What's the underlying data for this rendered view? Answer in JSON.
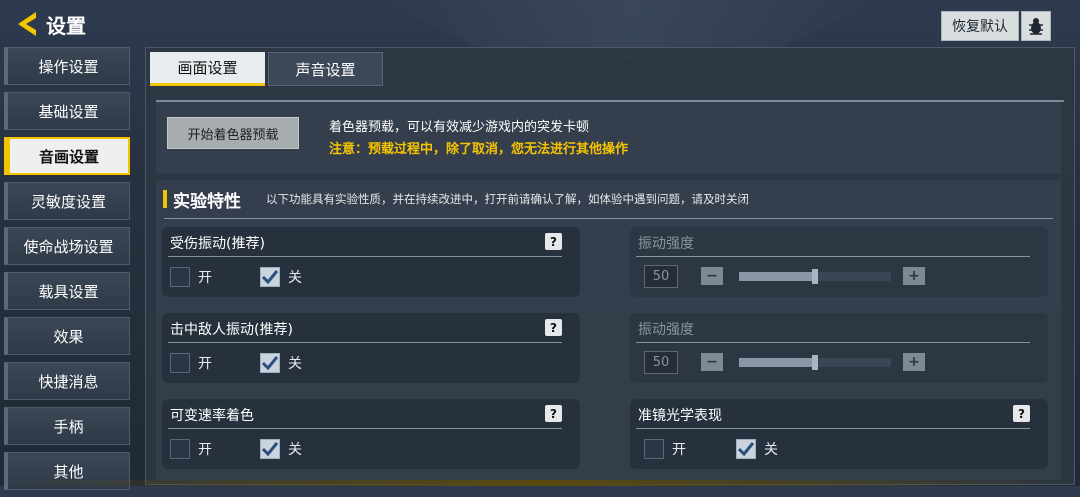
{
  "header": {
    "title": "设置",
    "restore_label": "恢复默认"
  },
  "sidebar": {
    "items": [
      {
        "label": "操作设置",
        "active": false
      },
      {
        "label": "基础设置",
        "active": false
      },
      {
        "label": "音画设置",
        "active": true
      },
      {
        "label": "灵敏度设置",
        "active": false
      },
      {
        "label": "使命战场设置",
        "active": false
      },
      {
        "label": "载具设置",
        "active": false
      },
      {
        "label": "效果",
        "active": false
      },
      {
        "label": "快捷消息",
        "active": false
      },
      {
        "label": "手柄",
        "active": false
      },
      {
        "label": "其他",
        "active": false
      }
    ]
  },
  "tabs": [
    {
      "label": "画面设置",
      "active": true
    },
    {
      "label": "声音设置",
      "active": false
    }
  ],
  "shader": {
    "button_label": "开始着色器预载",
    "note": "着色器预载，可以有效减少游戏内的突发卡顿",
    "warning": "注意：预载过程中，除了取消，您无法进行其他操作"
  },
  "experimental": {
    "title": "实验特性",
    "description": "以下功能具有实验性质，并在持续改进中，打开前请确认了解，如体验中遇到问题，请及时关闭"
  },
  "cards": {
    "hit_vibration": {
      "title": "受伤振动(推荐)",
      "help": "?",
      "on": "开",
      "off": "关",
      "selected": "off"
    },
    "hit_vibration_strength": {
      "title": "振动强度",
      "value": "50",
      "minus": "−",
      "plus": "+",
      "level": 0.5
    },
    "enemy_vibration": {
      "title": "击中敌人振动(推荐)",
      "help": "?",
      "on": "开",
      "off": "关",
      "selected": "off"
    },
    "enemy_vibration_strength": {
      "title": "振动强度",
      "value": "50",
      "minus": "−",
      "plus": "+",
      "level": 0.5
    },
    "vrs": {
      "title": "可变速率着色",
      "help": "?",
      "on": "开",
      "off": "关",
      "selected": "off"
    },
    "scope_optics": {
      "title": "准镜光学表现",
      "help": "?",
      "on": "开",
      "off": "关",
      "selected": "off"
    }
  },
  "colors": {
    "accent": "#f5c400",
    "panel": "#2d3744"
  },
  "icons": {
    "back": "back-arrow-icon",
    "bug": "bug-icon",
    "check": "checkmark-icon"
  }
}
